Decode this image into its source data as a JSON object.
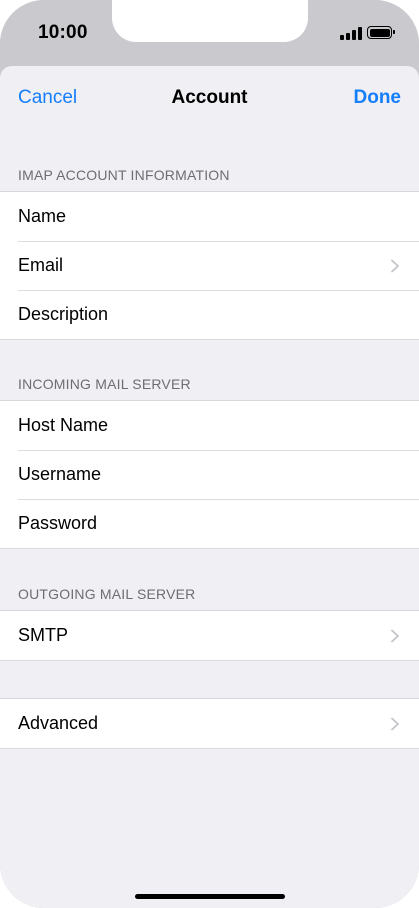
{
  "status_bar": {
    "time": "10:00",
    "signal_icon": "cellular-signal-icon",
    "battery_icon": "battery-full-icon"
  },
  "navbar": {
    "cancel_label": "Cancel",
    "title": "Account",
    "done_label": "Done"
  },
  "sections": [
    {
      "header": "IMAP ACCOUNT INFORMATION",
      "rows": [
        {
          "label": "Name",
          "chevron": false
        },
        {
          "label": "Email",
          "chevron": true
        },
        {
          "label": "Description",
          "chevron": false
        }
      ]
    },
    {
      "header": "INCOMING MAIL SERVER",
      "rows": [
        {
          "label": "Host Name",
          "chevron": false
        },
        {
          "label": "Username",
          "chevron": false
        },
        {
          "label": "Password",
          "chevron": false
        }
      ]
    },
    {
      "header": "OUTGOING MAIL SERVER",
      "rows": [
        {
          "label": "SMTP",
          "chevron": true
        }
      ]
    },
    {
      "header": "",
      "rows": [
        {
          "label": "Advanced",
          "chevron": true
        }
      ]
    }
  ],
  "colors": {
    "accent": "#147efb",
    "background": "#efeff4",
    "section_header": "#6d6d72",
    "status_bar_bg": "#c9c9ce"
  }
}
